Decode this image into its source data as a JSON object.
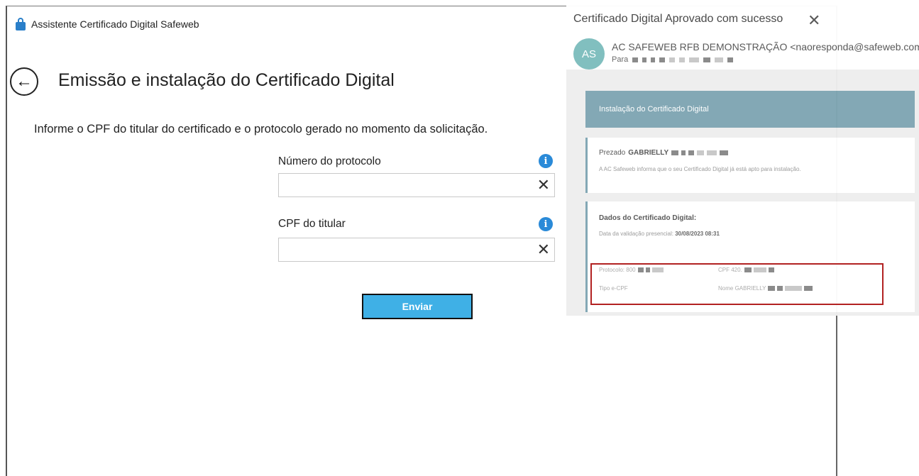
{
  "app": {
    "title": "Assistente Certificado Digital Safeweb",
    "page_title": "Emissão e instalação do Certificado Digital",
    "instruction": "Informe o CPF do titular do certificado e o protocolo gerado no momento da solicitação.",
    "fields": [
      {
        "label": "Número do protocolo",
        "value": "",
        "placeholder": ""
      },
      {
        "label": "CPF do titular",
        "value": "",
        "placeholder": ""
      }
    ],
    "submit_label": "Enviar",
    "icons": {
      "back": "arrow-left-icon",
      "info": "info-icon",
      "clear": "close-icon",
      "lock": "lock-icon"
    },
    "colors": {
      "accent": "#3fb0e6",
      "info": "#2a8ad8"
    }
  },
  "email": {
    "subject": "Certificado Digital Aprovado com sucesso",
    "close_glyph": "✕",
    "avatar_initials": "AS",
    "sender": "AC SAFEWEB RFB DEMONSTRAÇÃO <naoresponda@safeweb.com.br",
    "to_label": "Para",
    "header_bar": "Instalação do Certificado Digital",
    "greeting_prefix": "Prezado",
    "greeting_name": "GABRIELLY",
    "notice": "A AC Safeweb informa que o seu Certificado Digital já está apto para instalação.",
    "data_heading": "Dados do Certificado Digital:",
    "validation_label": "Data da validação presencial:",
    "validation_date": "30/08/2023 08:31",
    "protocol_label": "Protocolo: 800",
    "cpf_label": "CPF 420.",
    "type_label": "Tipo e-CPF",
    "name_label": "Nome GABRIELLY",
    "colors": {
      "header_bar": "#7fa6b3",
      "highlight": "#b22222",
      "avatar": "#7dbdbd"
    }
  }
}
